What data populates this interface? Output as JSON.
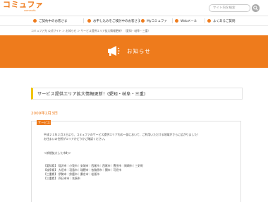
{
  "brand": {
    "name": "コミュファ",
    "sub": "commufa"
  },
  "search": {
    "placeholder": "サイト内を検索"
  },
  "nav": [
    {
      "label": "ご契約中のお客さま"
    },
    {
      "label": "お申し込みをご検討中のお客さま"
    },
    {
      "label": "Myコミュファ"
    },
    {
      "label": "Webメール"
    },
    {
      "label": "よくあるご質問"
    }
  ],
  "breadcrumb": "コミュファ光 公式サイト ＞ お知らせ ＞ サービス提供エリア拡大情報更新！（愛知・岐阜・三重）",
  "banner": {
    "title": "お知らせ"
  },
  "article": {
    "title": "サービス提供エリア拡大情報更新！(愛知・岐阜・三重)",
    "date": "2009年2月3日",
    "category": "サービス",
    "lines": [
      "平成２１年２月３日より、コミュファのサービス提供エリア内の一部において、ご利用いただける地域がさらに広がりました！",
      "お住まいの住所がエリアかどうかご確認ください。",
      "",
      "＜新規拡大した市町＞",
      "",
      "【愛知県】 稲沢市｜小牧市｜安城市｜西尾市｜西尾市｜豊田市｜岡崎市｜三好町",
      "【岐阜県】 大垣市｜羽島市｜瑞穂市｜各務原市｜関市｜可児市",
      "【三重県】 伊勢市｜鈴鹿市｜桑名市｜松阪市",
      "【三重県】 四日市市｜名張市"
    ]
  },
  "colors": {
    "accent": "#ee7b1c",
    "title_bar": "#f0c400"
  }
}
